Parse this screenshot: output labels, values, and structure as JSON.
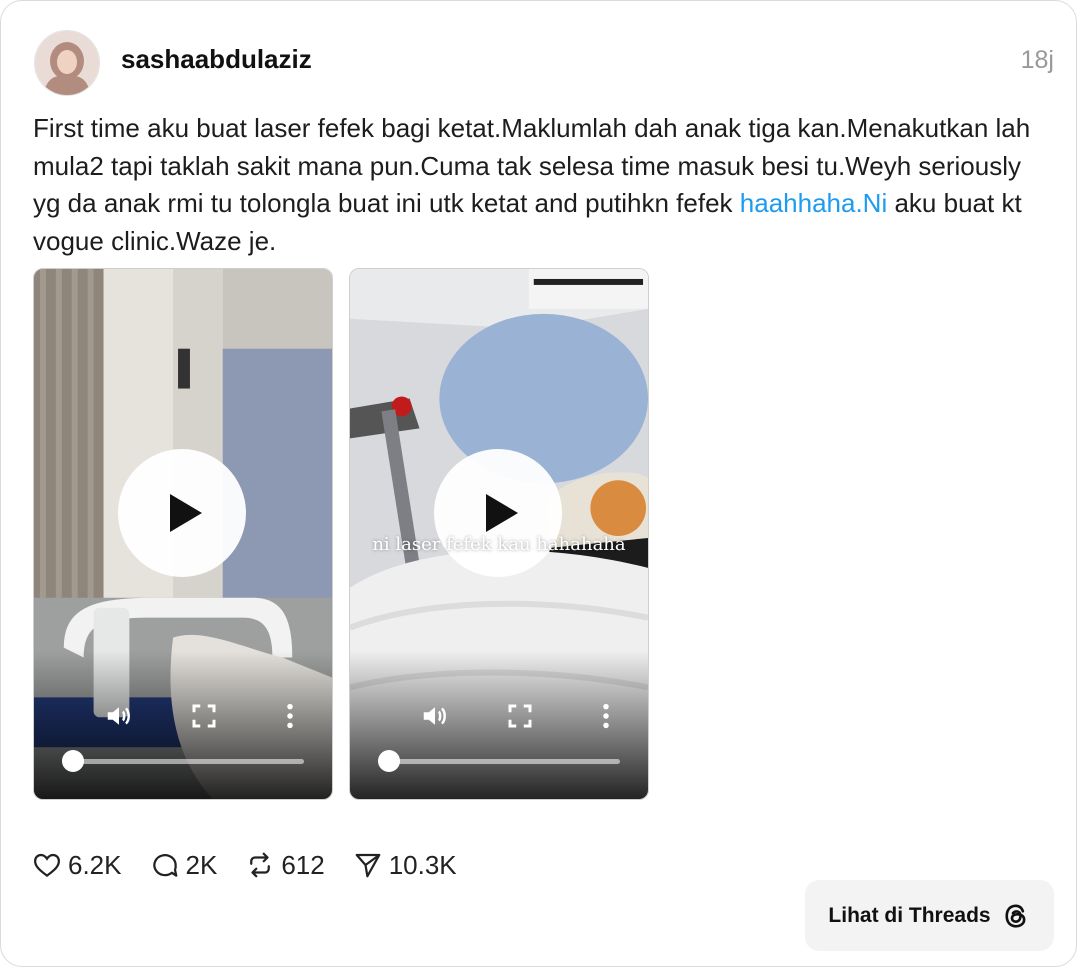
{
  "post": {
    "username": "sashaabdulaziz",
    "time_ago": "18j",
    "text_before_link": "First time aku buat laser fefek bagi ketat.Maklumlah dah anak tiga kan.Menakutkan lah mula2 tapi taklah sakit mana pun.Cuma tak selesa time masuk besi tu.Weyh seriously yg da anak rmi tu tolongla buat ini utk ketat and putihkn fefek ",
    "link_text": "haahhaha.Ni",
    "text_after_link": " aku buat kt vogue clinic.Waze je."
  },
  "videos": [
    {
      "overlay_caption": "",
      "progress": 0.0
    },
    {
      "overlay_caption": "ni laser fefek kau hahahaha",
      "progress": 0.0
    }
  ],
  "metrics": {
    "likes": "6.2K",
    "comments": "2K",
    "reposts": "612",
    "shares": "10.3K"
  },
  "cta": {
    "label": "Lihat di Threads",
    "icon": "threads-logo-icon"
  },
  "colors": {
    "link": "#1d9bf0",
    "muted": "#999999"
  }
}
